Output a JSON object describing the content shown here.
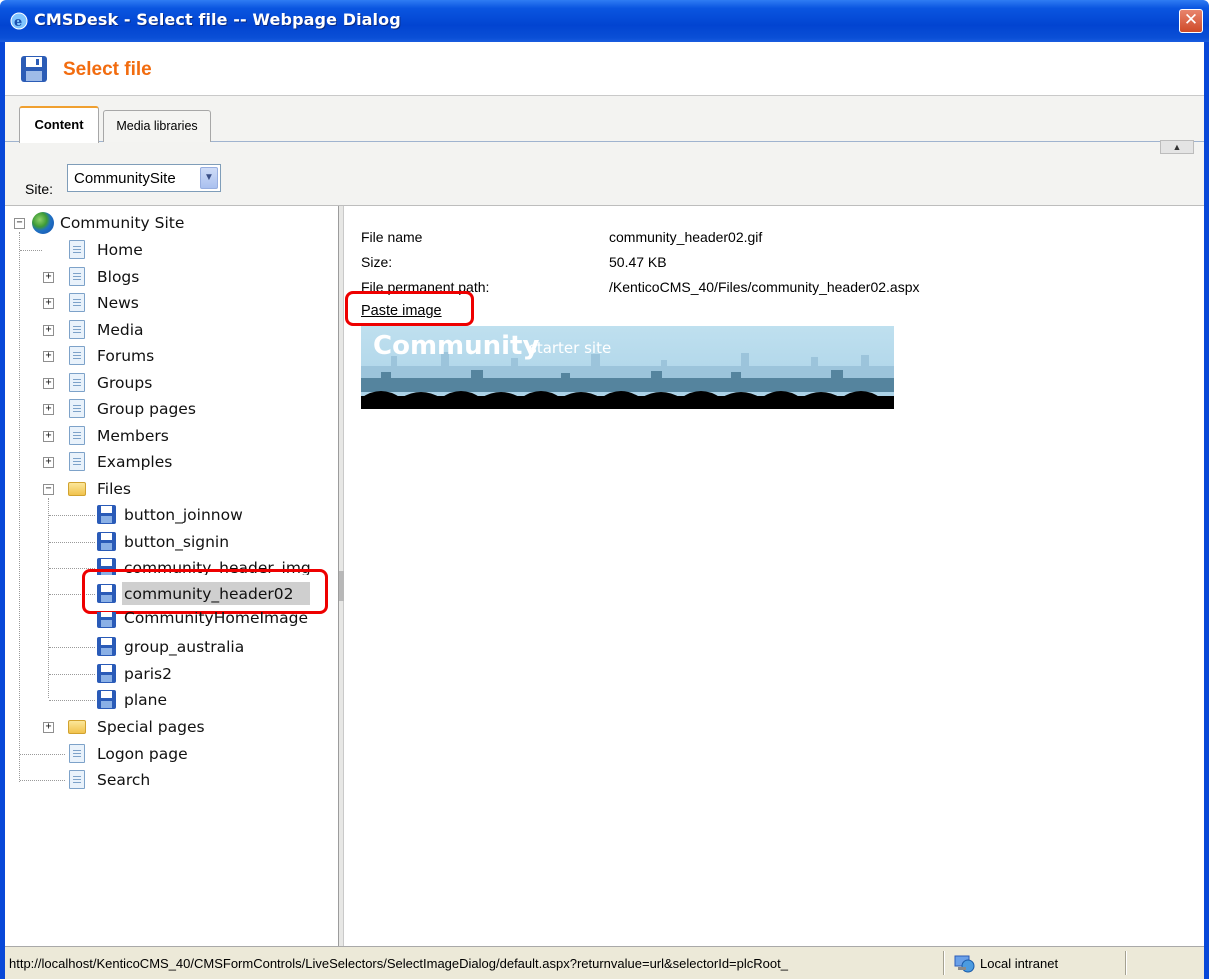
{
  "window": {
    "title": "CMSDesk - Select file -- Webpage Dialog",
    "close_symbol": "✕"
  },
  "header": {
    "title": "Select file"
  },
  "tabs": [
    {
      "label": "Content",
      "active": true
    },
    {
      "label": "Media libraries",
      "active": false
    }
  ],
  "site": {
    "label": "Site:",
    "selected": "CommunitySite"
  },
  "tree": {
    "root": "Community Site",
    "items": [
      "Home",
      "Blogs",
      "News",
      "Media",
      "Forums",
      "Groups",
      "Group pages",
      "Members",
      "Examples",
      "Files",
      "button_joinnow",
      "button_signin",
      "community_header_img",
      "community_header02",
      "CommunityHomeImage",
      "group_australia",
      "paris2",
      "plane",
      "Special pages",
      "Logon page",
      "Search"
    ]
  },
  "details": {
    "file_name_label": "File name",
    "file_name_value": "community_header02.gif",
    "size_label": "Size:",
    "size_value": "50.47 KB",
    "path_label": "File permanent path:",
    "path_value": "/KenticoCMS_40/Files/community_header02.aspx",
    "paste_link": "Paste image",
    "banner_word": "Community",
    "banner_subtitle": "starter site"
  },
  "status": {
    "url": "http://localhost/KenticoCMS_40/CMSFormControls/LiveSelectors/SelectImageDialog/default.aspx?returnvalue=url&selectorId=plcRoot_",
    "zone": "Local intranet"
  },
  "colors": {
    "accent": "#f26c0f",
    "titlebar": "#0a55e0",
    "highlight": "#e00000"
  }
}
